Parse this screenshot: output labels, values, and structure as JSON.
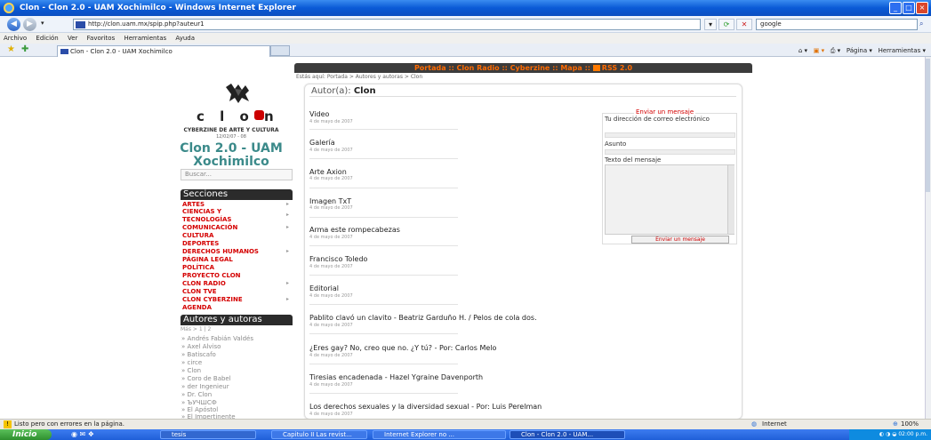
{
  "browser": {
    "title": "Clon - Clon 2.0 - UAM Xochimilco - Windows Internet Explorer",
    "url": "http://clon.uam.mx/spip.php?auteur1",
    "search_value": "google",
    "menu": [
      "Archivo",
      "Edición",
      "Ver",
      "Favoritos",
      "Herramientas",
      "Ayuda"
    ],
    "tab_title": "Clon - Clon 2.0 - UAM Xochimilco",
    "cmd_page": "Página",
    "cmd_tools": "Herramientas",
    "status_text": "Listo pero con errores en la página.",
    "zone": "Internet",
    "zoom": "100%"
  },
  "site": {
    "nav": "Portada :: Clon Radio :: Cyberzine :: Mapa ::",
    "rss": "RSS 2.0",
    "breadcrumb": "Estás aquí: Portada > Autores y autoras > Clon",
    "logo_text": "c l o n",
    "tagline": "CYBERZINE DE ARTE Y CULTURA",
    "date": "12/02/07 - 08",
    "name": "Clon 2.0 - UAM Xochimilco",
    "search_placeholder": "Buscar...",
    "sections_title": "Secciones",
    "sections": [
      "ARTES",
      "CIENCIAS Y",
      "TECNOLOGÍAS",
      "COMUNICACIÓN",
      "CULTURA",
      "DEPORTES",
      "DERECHOS HUMANOS",
      "PÁGINA LEGAL",
      "POLÍTICA",
      "PROYECTO CLON",
      "CLON RADIO",
      "CLON TVE",
      "CLON CYBERZINE",
      "AGENDA"
    ],
    "authors_title": "Autores y autoras",
    "authors_pages": "Más > 1 | 2",
    "authors": [
      "» Andrés Fabián Valdés",
      "» Axel Alviso",
      "» Batiscafo",
      "» circe",
      "» Clon",
      "» Coro de Babel",
      "» der Ingenieur",
      "» Dr. Clon",
      "» ЪУЧШСФ",
      "» El Apóstol",
      "» El Impertinente"
    ]
  },
  "main": {
    "title_prefix": "Autor(a):",
    "title_name": "Clon",
    "articles": [
      {
        "title": "Video",
        "date": "4 de mayo de 2007"
      },
      {
        "title": "Galería",
        "date": "4 de mayo de 2007"
      },
      {
        "title": "Arte Axion",
        "date": "4 de mayo de 2007"
      },
      {
        "title": "Imagen TxT",
        "date": "4 de mayo de 2007"
      },
      {
        "title": "Arma este rompecabezas",
        "date": "4 de mayo de 2007"
      },
      {
        "title": "Francisco Toledo",
        "date": "4 de mayo de 2007"
      },
      {
        "title": "Editorial",
        "date": "4 de mayo de 2007"
      },
      {
        "title": "Pablito clavó un clavito - Beatriz Garduño H. / Pelos de cola dos.",
        "date": "4 de mayo de 2007"
      },
      {
        "title": "¿Eres gay? No, creo que no. ¿Y tú? - Por: Carlos Melo",
        "date": "4 de mayo de 2007"
      },
      {
        "title": "Tiresias encadenada - Hazel Ygraine Davenporth",
        "date": "4 de mayo de 2007"
      },
      {
        "title": "Los derechos sexuales y la diversidad sexual - Por: Luis Perelman",
        "date": "4 de mayo de 2007"
      }
    ],
    "form": {
      "legend": "Enviar un mensaje",
      "email_label": "Tu dirección de correo electrónico",
      "subject_label": "Asunto",
      "message_label": "Texto del mensaje",
      "submit": "Enviar un mensaje"
    }
  },
  "taskbar": {
    "start": "Inicio",
    "items": [
      "tesis",
      "Capitulo II Las revist...",
      "Internet Explorer no ...",
      "Clon - Clon 2.0 - UAM..."
    ],
    "clock": "02:00 p.m."
  }
}
